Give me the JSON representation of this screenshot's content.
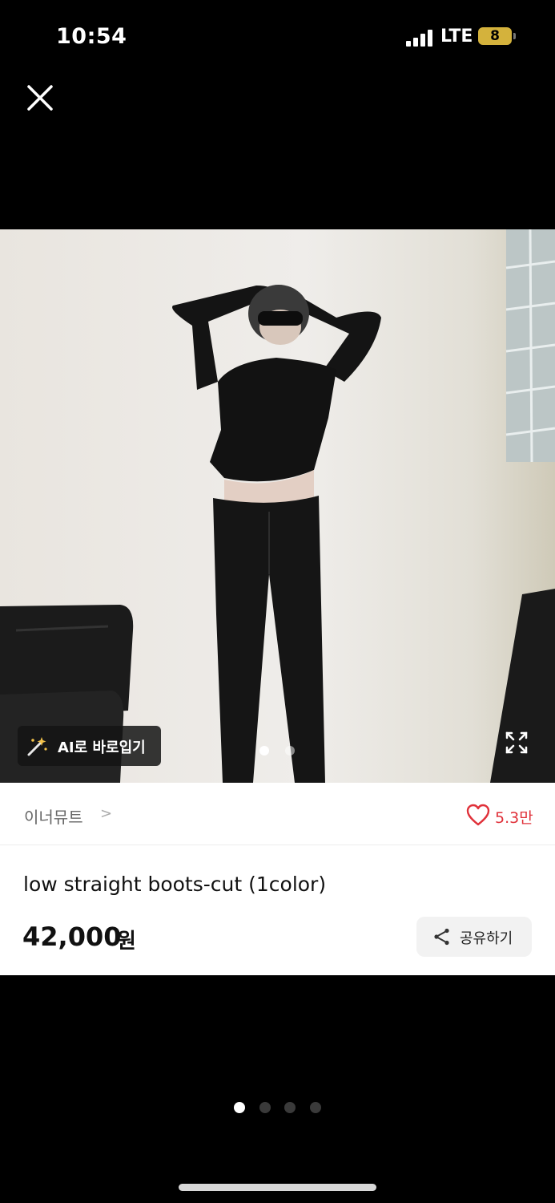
{
  "status_bar": {
    "time": "10:54",
    "network": "LTE",
    "battery": "8"
  },
  "photo": {
    "ai_button_label": "AI로 바로입기",
    "dots_total": 2,
    "dots_active": 0
  },
  "product": {
    "brand": "이너뮤트",
    "brand_chevron": ">",
    "likes": "5.3만",
    "title": "low straight boots-cut (1color)",
    "price": "42,000",
    "currency": "원",
    "share_label": "공유하기"
  },
  "pager": {
    "total": 4,
    "active": 0
  },
  "colors": {
    "like_red": "#e0313a",
    "accent_bg": "#f2f2f2"
  },
  "icons": [
    "close-icon",
    "magic-wand-icon",
    "expand-icon",
    "heart-icon",
    "share-icon"
  ]
}
